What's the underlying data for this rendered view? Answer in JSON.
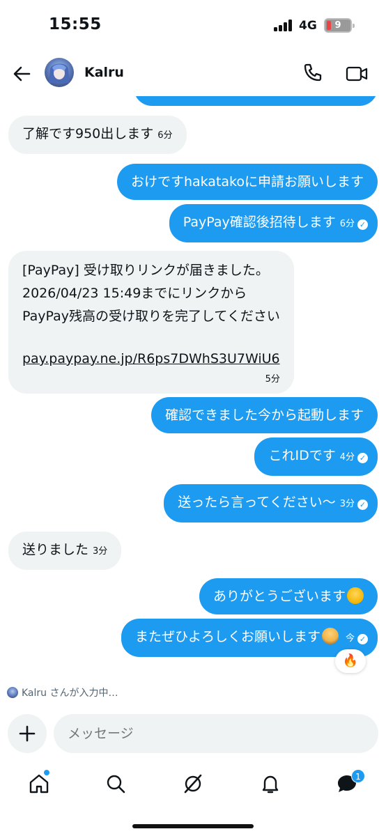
{
  "status_bar": {
    "time": "15:55",
    "network": "4G",
    "battery": "9"
  },
  "header": {
    "contact_name": "Kalru"
  },
  "messages": [
    {
      "dir": "in",
      "text": "了解です950出します",
      "time": "6分"
    },
    {
      "dir": "out",
      "text": "おけですhakatakoに申請お願いします",
      "time": ""
    },
    {
      "dir": "out",
      "text": "PayPay確認後招待します",
      "time": "6分"
    },
    {
      "dir": "in",
      "lines": [
        "[PayPay] 受け取りリンクが届きました。",
        "2026/04/23 15:49までにリンクから",
        "PayPay残高の受け取りを完了してください"
      ],
      "link": "pay.paypay.ne.jp/R6ps7DWhS3U7WiU6",
      "time": "5分"
    },
    {
      "dir": "out",
      "text": "確認できました今から起動します",
      "time": ""
    },
    {
      "dir": "out",
      "text": "これIDです",
      "time": "4分"
    },
    {
      "dir": "out",
      "text": "送ったら言ってください〜",
      "time": "3分"
    },
    {
      "dir": "in",
      "text": "送りました",
      "time": "3分"
    },
    {
      "dir": "out",
      "text": "ありがとうございます",
      "emoji": "loudly-crying-face-emoji",
      "time": ""
    },
    {
      "dir": "out",
      "text": "またぜひよろしくお願いします",
      "emoji": "bowing-person-emoji",
      "time": "今"
    }
  ],
  "reaction": {
    "icon": "fire-emoji",
    "glyph": "🔥"
  },
  "typing_indicator": "Kalru さんが入力中…",
  "composer": {
    "placeholder": "メッセージ"
  },
  "bottom_nav": {
    "items": [
      "home-icon",
      "search-icon",
      "grok-icon",
      "notifications-icon",
      "messages-icon"
    ],
    "messages_badge": "1"
  },
  "colors": {
    "accent": "#1d9bf0",
    "incoming_bubble": "#eff3f4",
    "text": "#0f1419"
  }
}
